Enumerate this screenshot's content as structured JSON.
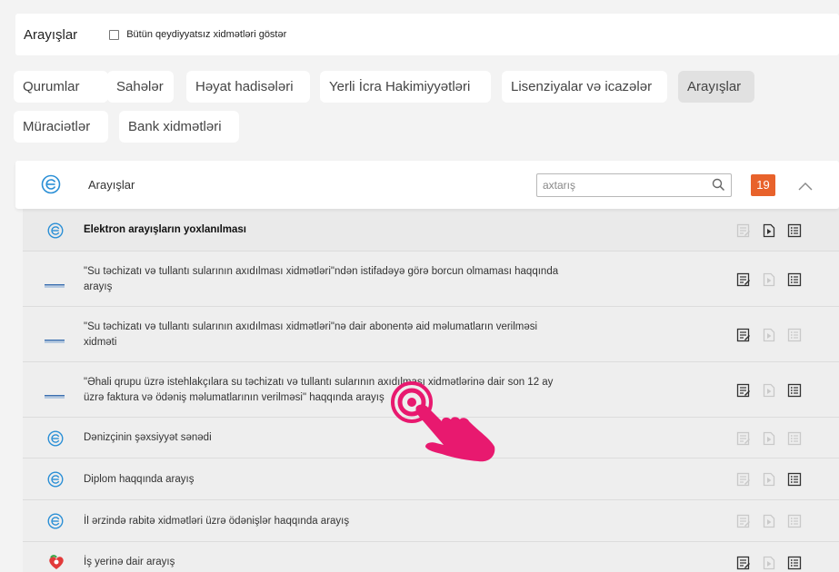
{
  "topbar": {
    "title": "Arayışlar",
    "checkbox_label": "Bütün qeydiyyatsız xidmətləri göstər",
    "checkbox_checked": false
  },
  "categories": [
    {
      "label": "Qurumlar",
      "active": false
    },
    {
      "label": "Sahələr",
      "active": false
    },
    {
      "label": "Həyat hadisələri",
      "active": false
    },
    {
      "label": "Yerli İcra Hakimiyyətləri",
      "active": false
    },
    {
      "label": "Lisenziyalar və icazələr",
      "active": false
    },
    {
      "label": "Arayışlar",
      "active": true
    },
    {
      "label": "Müraciətlər",
      "active": false
    },
    {
      "label": "Bank xidmətləri",
      "active": false
    }
  ],
  "panel": {
    "title": "Arayışlar",
    "search_placeholder": "axtarış",
    "count": "19"
  },
  "services": [
    {
      "icon": "e-gov-icon",
      "text": "Elektron arayışların yoxlanılması",
      "bold": true,
      "actions": [
        false,
        true,
        true
      ]
    },
    {
      "icon": "azersu-logo-icon",
      "text": "\"Su təchizatı və tullantı sularının axıdılması xidmətləri\"ndən istifadəyə görə borcun olmaması haqqında arayış",
      "bold": false,
      "actions": [
        true,
        false,
        true
      ]
    },
    {
      "icon": "azersu-logo-icon",
      "text": "\"Su təchizatı və tullantı sularının axıdılması xidmətləri\"nə dair abonentə aid məlumatların verilməsi xidməti",
      "bold": false,
      "actions": [
        true,
        false,
        false
      ]
    },
    {
      "icon": "azersu-logo-icon",
      "text": "\"Əhali qrupu üzrə istehlakçılara su təchizatı və tullantı sularının axıdılması xidmətlərinə dair son 12 ay üzrə faktura və ödəniş məlumatlarının verilməsi\" haqqında arayış",
      "bold": false,
      "actions": [
        true,
        false,
        true
      ]
    },
    {
      "icon": "e-gov-icon",
      "text": "Dənizçinin şəxsiyyət sənədi",
      "bold": false,
      "actions": [
        false,
        false,
        false
      ]
    },
    {
      "icon": "e-gov-icon",
      "text": "Diplom haqqında arayış",
      "bold": false,
      "actions": [
        false,
        false,
        true
      ]
    },
    {
      "icon": "e-gov-icon",
      "text": "İl ərzində rabitə xidmətləri üzrə ödənişlər haqqında arayış",
      "bold": false,
      "actions": [
        false,
        false,
        false
      ]
    },
    {
      "icon": "heart-logo-icon",
      "text": "İş yerinə dair arayış",
      "bold": false,
      "actions": [
        true,
        false,
        true
      ]
    }
  ],
  "colors": {
    "accent": "#e8622b",
    "egov_blue": "#2a8fd6",
    "cursor_pink": "#e8196f"
  }
}
